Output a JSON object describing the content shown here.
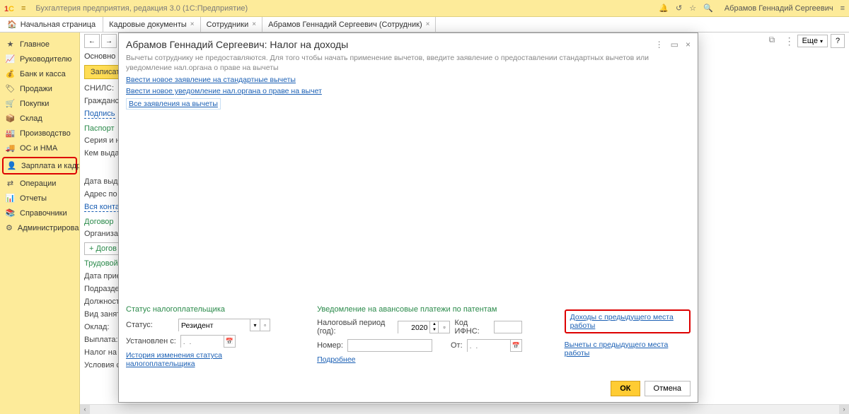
{
  "app": {
    "title": "Бухгалтерия предприятия, редакция 3.0  (1С:Предприятие)",
    "user": "Абрамов Геннадий Сергеевич"
  },
  "tabs": {
    "home": "Начальная страница",
    "t1": "Кадровые документы",
    "t2": "Сотрудники",
    "t3": "Абрамов Геннадий Сергеевич (Сотрудник)"
  },
  "sidebar": {
    "items": [
      {
        "label": "Главное"
      },
      {
        "label": "Руководителю"
      },
      {
        "label": "Банк и касса"
      },
      {
        "label": "Продажи"
      },
      {
        "label": "Покупки"
      },
      {
        "label": "Склад"
      },
      {
        "label": "Производство"
      },
      {
        "label": "ОС и НМА"
      },
      {
        "label": "Зарплата и кадры"
      },
      {
        "label": "Операции"
      },
      {
        "label": "Отчеты"
      },
      {
        "label": "Справочники"
      },
      {
        "label": "Администрирование"
      }
    ]
  },
  "toolbar": {
    "more": "Еще",
    "help": "?"
  },
  "bg": {
    "tab_main": "Основно",
    "save": "Записат",
    "snils": "СНИЛС:",
    "citizenship": "Гражданст",
    "signature": "Подпись",
    "passport_title": "Паспорт",
    "series_no": "Серия и но",
    "issued_by": "Кем выдан",
    "issue_date": "Дата выда",
    "address": "Адрес по п",
    "all_contacts": "Вся контак",
    "contracts_title": "Договор",
    "organization": "Организац",
    "add_contract": "Догов",
    "labor_contract": "Трудовой д",
    "hire_date": "Дата прие",
    "department": "Подраздел",
    "position": "Должность",
    "employment": "Вид занят",
    "salary": "Оклад:",
    "payout": "Выплата:",
    "tax": "Налог на д",
    "conditions": "Условия ст"
  },
  "modal": {
    "title": "Абрамов Геннадий Сергеевич: Налог на доходы",
    "info": "Вычеты сотруднику не предоставляются. Для того чтобы начать применение вычетов, введите заявление о предоставлении стандартных вычетов или уведомление нал.органа о праве на вычеты",
    "link_std": "Ввести новое заявление на стандартные вычеты",
    "link_notice": "Ввести новое уведомление нал.органа о праве на вычет",
    "link_all": "Все заявления на вычеты",
    "sec_status": "Статус налогоплательщика",
    "status_label": "Статус:",
    "status_value": "Резидент",
    "set_from": "Установлен с:",
    "date_placeholder": ".  .",
    "history": "История изменения статуса налогоплательщика",
    "sec_patent": "Уведомление на авансовые платежи по патентам",
    "tax_period": "Налоговый период (год):",
    "year": "2020",
    "ifns": "Код ИФНС:",
    "number": "Номер:",
    "from": "От:",
    "more": "Подробнее",
    "link_income": "Доходы с предыдущего места работы",
    "link_deduct": "Вычеты с предыдущего места работы",
    "ok": "ОК",
    "cancel": "Отмена"
  }
}
